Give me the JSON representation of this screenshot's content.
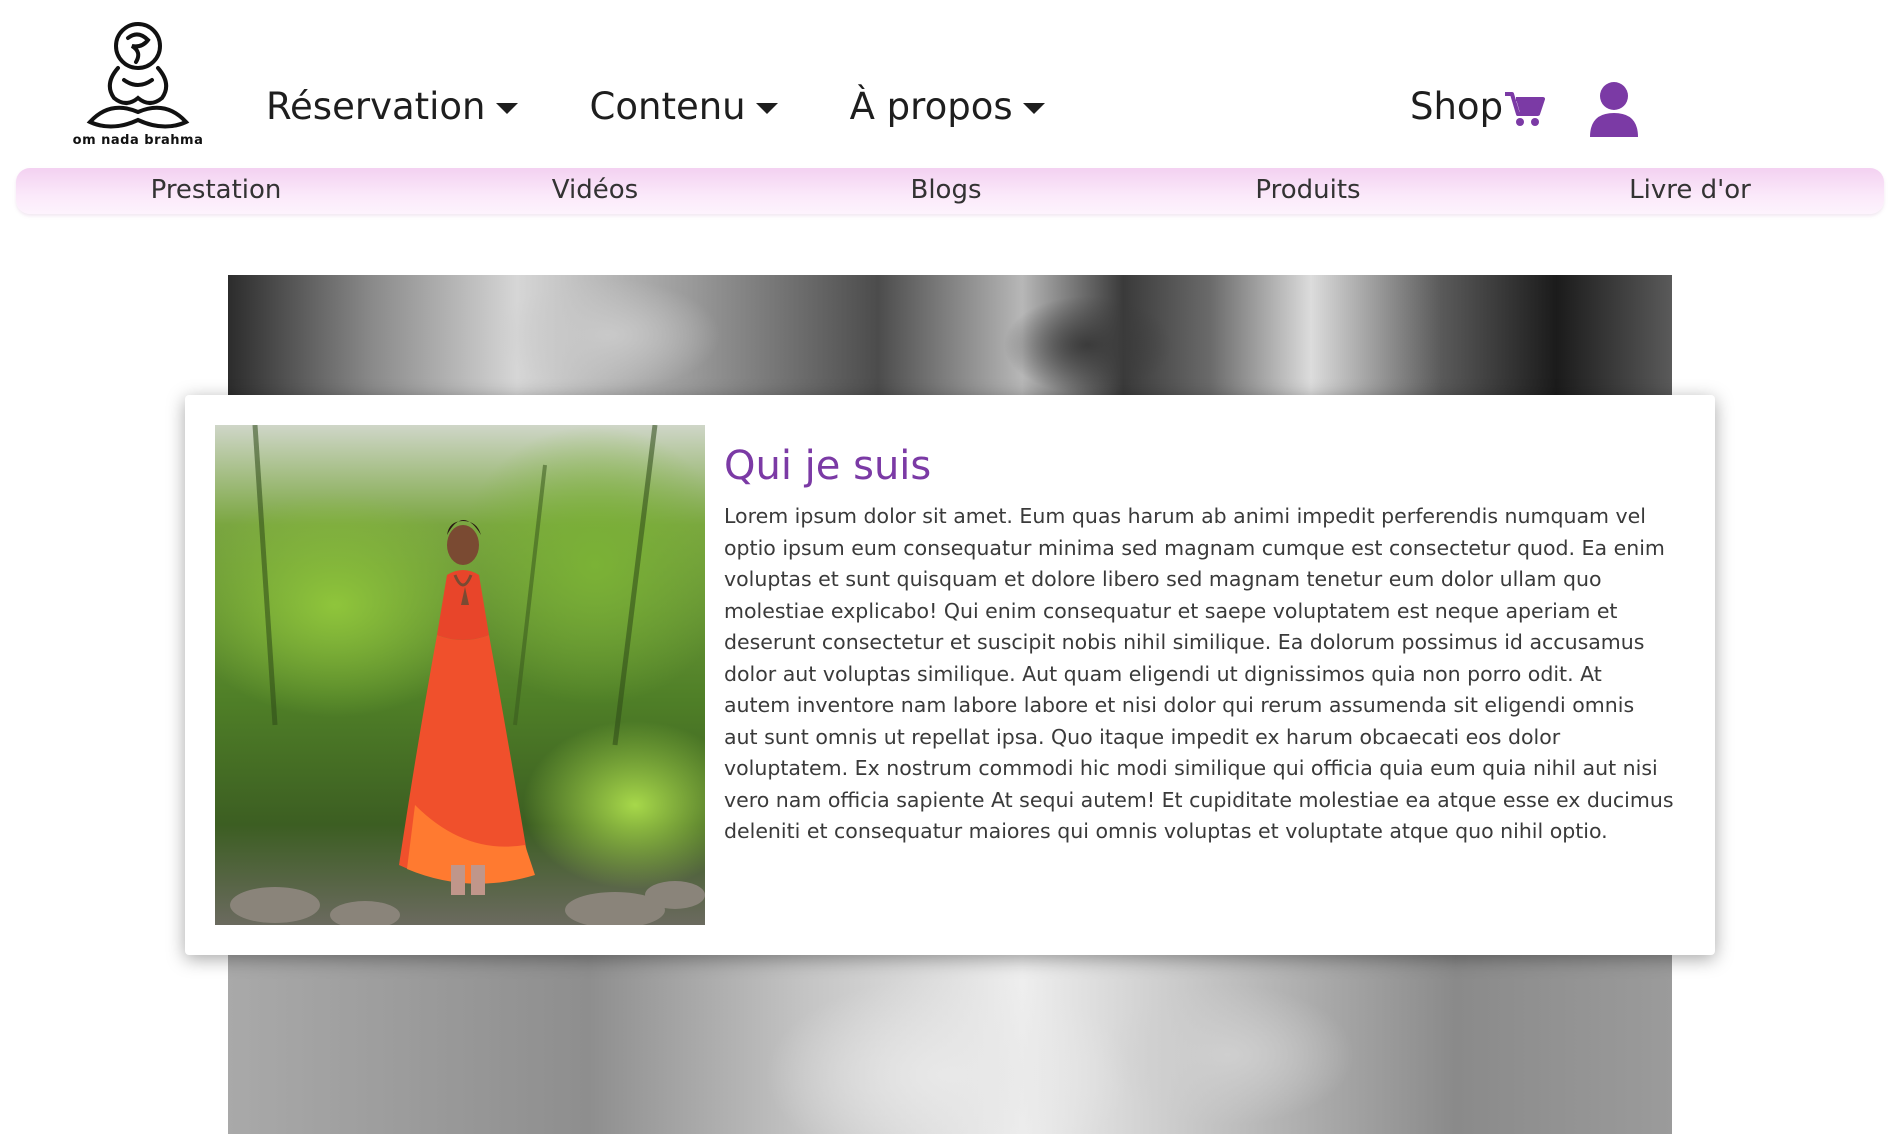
{
  "brand": {
    "logo_icon": "om-meditation-logo",
    "logo_text": "om nada brahma"
  },
  "header": {
    "nav": [
      {
        "label": "Réservation",
        "icon": "caret-down-icon"
      },
      {
        "label": "Contenu",
        "icon": "caret-down-icon"
      },
      {
        "label": "À propos",
        "icon": "caret-down-icon"
      }
    ],
    "shop_label": "Shop",
    "shop_icon": "shopping-cart-icon",
    "user_icon": "user-icon"
  },
  "sub_nav": {
    "items": [
      {
        "label": "Prestation"
      },
      {
        "label": "Vidéos"
      },
      {
        "label": "Blogs"
      },
      {
        "label": "Produits"
      },
      {
        "label": "Livre d'or"
      }
    ]
  },
  "about": {
    "title": "Qui je suis",
    "text": "Lorem ipsum dolor sit amet. Eum quas harum ab animi impedit perferendis numquam vel optio ipsum eum consequatur minima sed magnam cumque est consectetur quod. Ea enim voluptas et sunt quisquam et dolore libero sed magnam tenetur eum dolor ullam quo molestiae explicabo! Qui enim consequatur et saepe voluptatem est neque aperiam et deserunt consectetur et suscipit nobis nihil similique. Ea dolorum possimus id accusamus dolor aut voluptas similique. Aut quam eligendi ut dignissimos quia non porro odit. At autem inventore nam labore labore et nisi dolor qui rerum assumenda sit eligendi omnis aut sunt omnis ut repellat ipsa. Quo itaque impedit ex harum obcaecati eos dolor voluptatem. Ex nostrum commodi hic modi similique qui officia quia eum quia nihil aut nisi vero nam officia sapiente At sequi autem! Et cupiditate molestiae ea atque esse ex ducimus deleniti et consequatur maiores qui omnis voluptas et voluptate atque quo nihil optio."
  },
  "colors": {
    "accent_purple": "#7b3aa5",
    "subnav_pink": "#f3d1f1",
    "text_dark": "#1e1e1e"
  }
}
